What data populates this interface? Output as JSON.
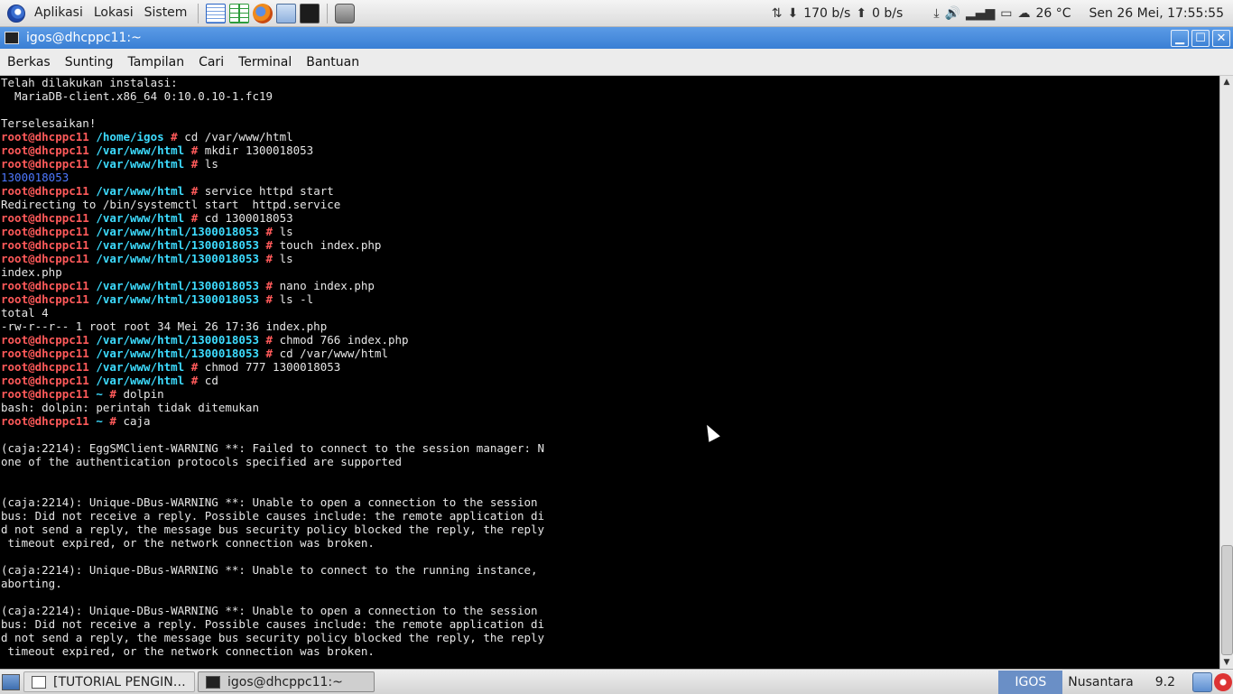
{
  "top_panel": {
    "menus": [
      "Aplikasi",
      "Lokasi",
      "Sistem"
    ],
    "launchers": [
      "writer-icon",
      "calc-icon",
      "firefox-icon",
      "file-manager-icon",
      "terminal-icon",
      "camera-icon"
    ],
    "net_down": "170 b/s",
    "net_up": "0 b/s",
    "temperature": "26 °C",
    "clock": "Sen 26 Mei, 17:55:55"
  },
  "window": {
    "title": "igos@dhcppc11:~",
    "menu": [
      "Berkas",
      "Sunting",
      "Tampilan",
      "Cari",
      "Terminal",
      "Bantuan"
    ]
  },
  "terminal": {
    "lines": [
      {
        "t": "plain",
        "text": "Telah dilakukan instalasi:"
      },
      {
        "t": "plain",
        "text": "  MariaDB-client.x86_64 0:10.0.10-1.fc19"
      },
      {
        "t": "plain",
        "text": ""
      },
      {
        "t": "plain",
        "text": "Terselesaikan!"
      },
      {
        "t": "cmd",
        "user": "root@dhcppc11",
        "path": "/home/igos",
        "cmd": "cd /var/www/html"
      },
      {
        "t": "cmd",
        "user": "root@dhcppc11",
        "path": "/var/www/html",
        "cmd": "mkdir 1300018053"
      },
      {
        "t": "cmd",
        "user": "root@dhcppc11",
        "path": "/var/www/html",
        "cmd": "ls"
      },
      {
        "t": "dir",
        "text": "1300018053"
      },
      {
        "t": "cmd",
        "user": "root@dhcppc11",
        "path": "/var/www/html",
        "cmd": "service httpd start"
      },
      {
        "t": "plain",
        "text": "Redirecting to /bin/systemctl start  httpd.service"
      },
      {
        "t": "cmd",
        "user": "root@dhcppc11",
        "path": "/var/www/html",
        "cmd": "cd 1300018053"
      },
      {
        "t": "cmd",
        "user": "root@dhcppc11",
        "path": "/var/www/html/1300018053",
        "cmd": "ls"
      },
      {
        "t": "cmd",
        "user": "root@dhcppc11",
        "path": "/var/www/html/1300018053",
        "cmd": "touch index.php"
      },
      {
        "t": "cmd",
        "user": "root@dhcppc11",
        "path": "/var/www/html/1300018053",
        "cmd": "ls"
      },
      {
        "t": "plain",
        "text": "index.php"
      },
      {
        "t": "cmd",
        "user": "root@dhcppc11",
        "path": "/var/www/html/1300018053",
        "cmd": "nano index.php"
      },
      {
        "t": "cmd",
        "user": "root@dhcppc11",
        "path": "/var/www/html/1300018053",
        "cmd": "ls -l"
      },
      {
        "t": "plain",
        "text": "total 4"
      },
      {
        "t": "plain",
        "text": "-rw-r--r-- 1 root root 34 Mei 26 17:36 index.php"
      },
      {
        "t": "cmd",
        "user": "root@dhcppc11",
        "path": "/var/www/html/1300018053",
        "cmd": "chmod 766 index.php"
      },
      {
        "t": "cmd",
        "user": "root@dhcppc11",
        "path": "/var/www/html/1300018053",
        "cmd": "cd /var/www/html"
      },
      {
        "t": "cmd",
        "user": "root@dhcppc11",
        "path": "/var/www/html",
        "cmd": "chmod 777 1300018053"
      },
      {
        "t": "cmd",
        "user": "root@dhcppc11",
        "path": "/var/www/html",
        "cmd": "cd"
      },
      {
        "t": "cmd",
        "user": "root@dhcppc11",
        "path": "~",
        "cmd": "dolpin"
      },
      {
        "t": "plain",
        "text": "bash: dolpin: perintah tidak ditemukan"
      },
      {
        "t": "cmd",
        "user": "root@dhcppc11",
        "path": "~",
        "cmd": "caja"
      },
      {
        "t": "plain",
        "text": ""
      },
      {
        "t": "plain",
        "text": "(caja:2214): EggSMClient-WARNING **: Failed to connect to the session manager: N"
      },
      {
        "t": "plain",
        "text": "one of the authentication protocols specified are supported"
      },
      {
        "t": "plain",
        "text": ""
      },
      {
        "t": "plain",
        "text": ""
      },
      {
        "t": "plain",
        "text": "(caja:2214): Unique-DBus-WARNING **: Unable to open a connection to the session"
      },
      {
        "t": "plain",
        "text": "bus: Did not receive a reply. Possible causes include: the remote application di"
      },
      {
        "t": "plain",
        "text": "d not send a reply, the message bus security policy blocked the reply, the reply"
      },
      {
        "t": "plain",
        "text": " timeout expired, or the network connection was broken."
      },
      {
        "t": "plain",
        "text": ""
      },
      {
        "t": "plain",
        "text": "(caja:2214): Unique-DBus-WARNING **: Unable to connect to the running instance,"
      },
      {
        "t": "plain",
        "text": "aborting."
      },
      {
        "t": "plain",
        "text": ""
      },
      {
        "t": "plain",
        "text": "(caja:2214): Unique-DBus-WARNING **: Unable to open a connection to the session"
      },
      {
        "t": "plain",
        "text": "bus: Did not receive a reply. Possible causes include: the remote application di"
      },
      {
        "t": "plain",
        "text": "d not send a reply, the message bus security policy blocked the reply, the reply"
      },
      {
        "t": "plain",
        "text": " timeout expired, or the network connection was broken."
      }
    ]
  },
  "taskbar": {
    "tasks": [
      "[TUTORIAL PENGINST...",
      "igos@dhcppc11:~"
    ],
    "workspace": "IGOS",
    "keyboard": "Nusantara",
    "version": "9.2"
  },
  "colors": {
    "user": "#ff5a5a",
    "path": "#3ddcff",
    "directory": "#4e78ff",
    "titlebar": "#3a7fd4"
  }
}
